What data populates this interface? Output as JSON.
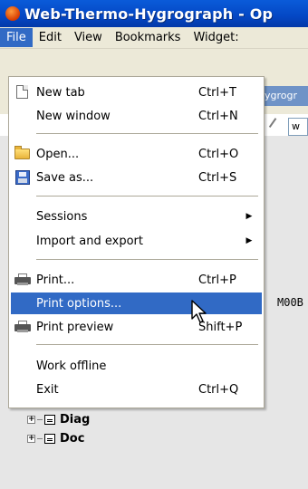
{
  "window": {
    "title": "Web-Thermo-Hygrograph - Op"
  },
  "menubar": {
    "items": [
      {
        "label": "File",
        "active": true
      },
      {
        "label": "Edit"
      },
      {
        "label": "View"
      },
      {
        "label": "Bookmarks"
      },
      {
        "label": "Widget:"
      }
    ]
  },
  "background": {
    "tab_text": "ygrogr",
    "address_text": "w",
    "code_text": "M00B",
    "tree": [
      {
        "label": "Diag",
        "expander": "+"
      },
      {
        "label": "Doc",
        "expander": "+"
      }
    ]
  },
  "file_menu": {
    "items": [
      {
        "type": "item",
        "label": "New tab",
        "shortcut": "Ctrl+T",
        "icon": "new-tab-icon"
      },
      {
        "type": "item",
        "label": "New window",
        "shortcut": "Ctrl+N"
      },
      {
        "type": "separator"
      },
      {
        "type": "item",
        "label": "Open...",
        "shortcut": "Ctrl+O",
        "icon": "open-folder-icon"
      },
      {
        "type": "item",
        "label": "Save as...",
        "shortcut": "Ctrl+S",
        "icon": "save-disk-icon"
      },
      {
        "type": "separator"
      },
      {
        "type": "item",
        "label": "Sessions",
        "submenu": true
      },
      {
        "type": "item",
        "label": "Import and export",
        "submenu": true
      },
      {
        "type": "separator"
      },
      {
        "type": "item",
        "label": "Print...",
        "shortcut": "Ctrl+P",
        "icon": "printer-icon"
      },
      {
        "type": "item",
        "label": "Print options...",
        "highlighted": true
      },
      {
        "type": "item",
        "label": "Print preview",
        "shortcut": "Shift+P",
        "icon": "printer-icon"
      },
      {
        "type": "separator"
      },
      {
        "type": "item",
        "label": "Work offline"
      },
      {
        "type": "item",
        "label": "Exit",
        "shortcut": "Ctrl+Q"
      }
    ]
  },
  "colors": {
    "title_bar": "#0447c4",
    "highlight": "#316ac5",
    "menu_bg": "#ffffff"
  }
}
